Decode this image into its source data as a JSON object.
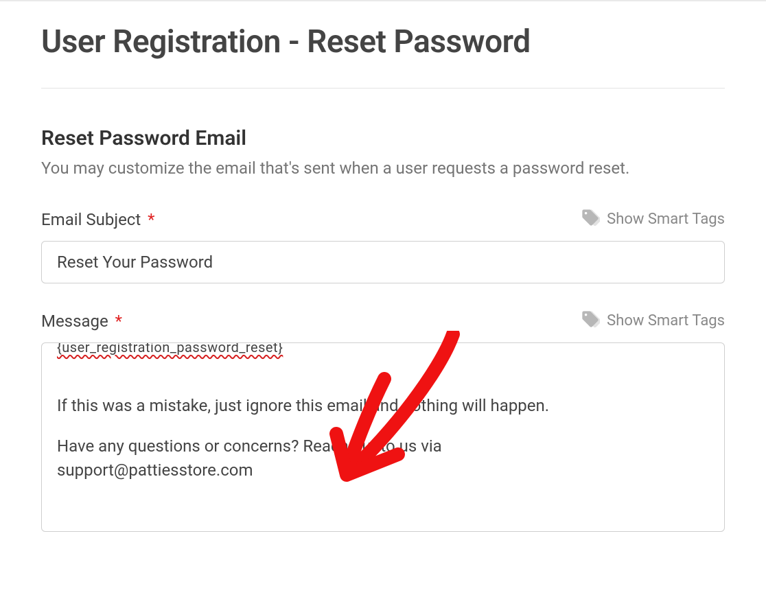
{
  "page": {
    "title": "User Registration - Reset Password"
  },
  "section": {
    "title": "Reset Password Email",
    "description": "You may customize the email that's sent when a user requests a password reset."
  },
  "smart_tags_label": "Show Smart Tags",
  "fields": {
    "subject": {
      "label": "Email Subject",
      "required_mark": "*",
      "value": "Reset Your Password"
    },
    "message": {
      "label": "Message",
      "required_mark": "*",
      "clipped_shortcode": "{user_registration_password_reset}",
      "line1": "If this was a mistake, just ignore this email and nothing will happen.",
      "line2a": "Have any questions or concerns? Reach out to us via",
      "line2b": "support@pattiesstore.com"
    }
  }
}
